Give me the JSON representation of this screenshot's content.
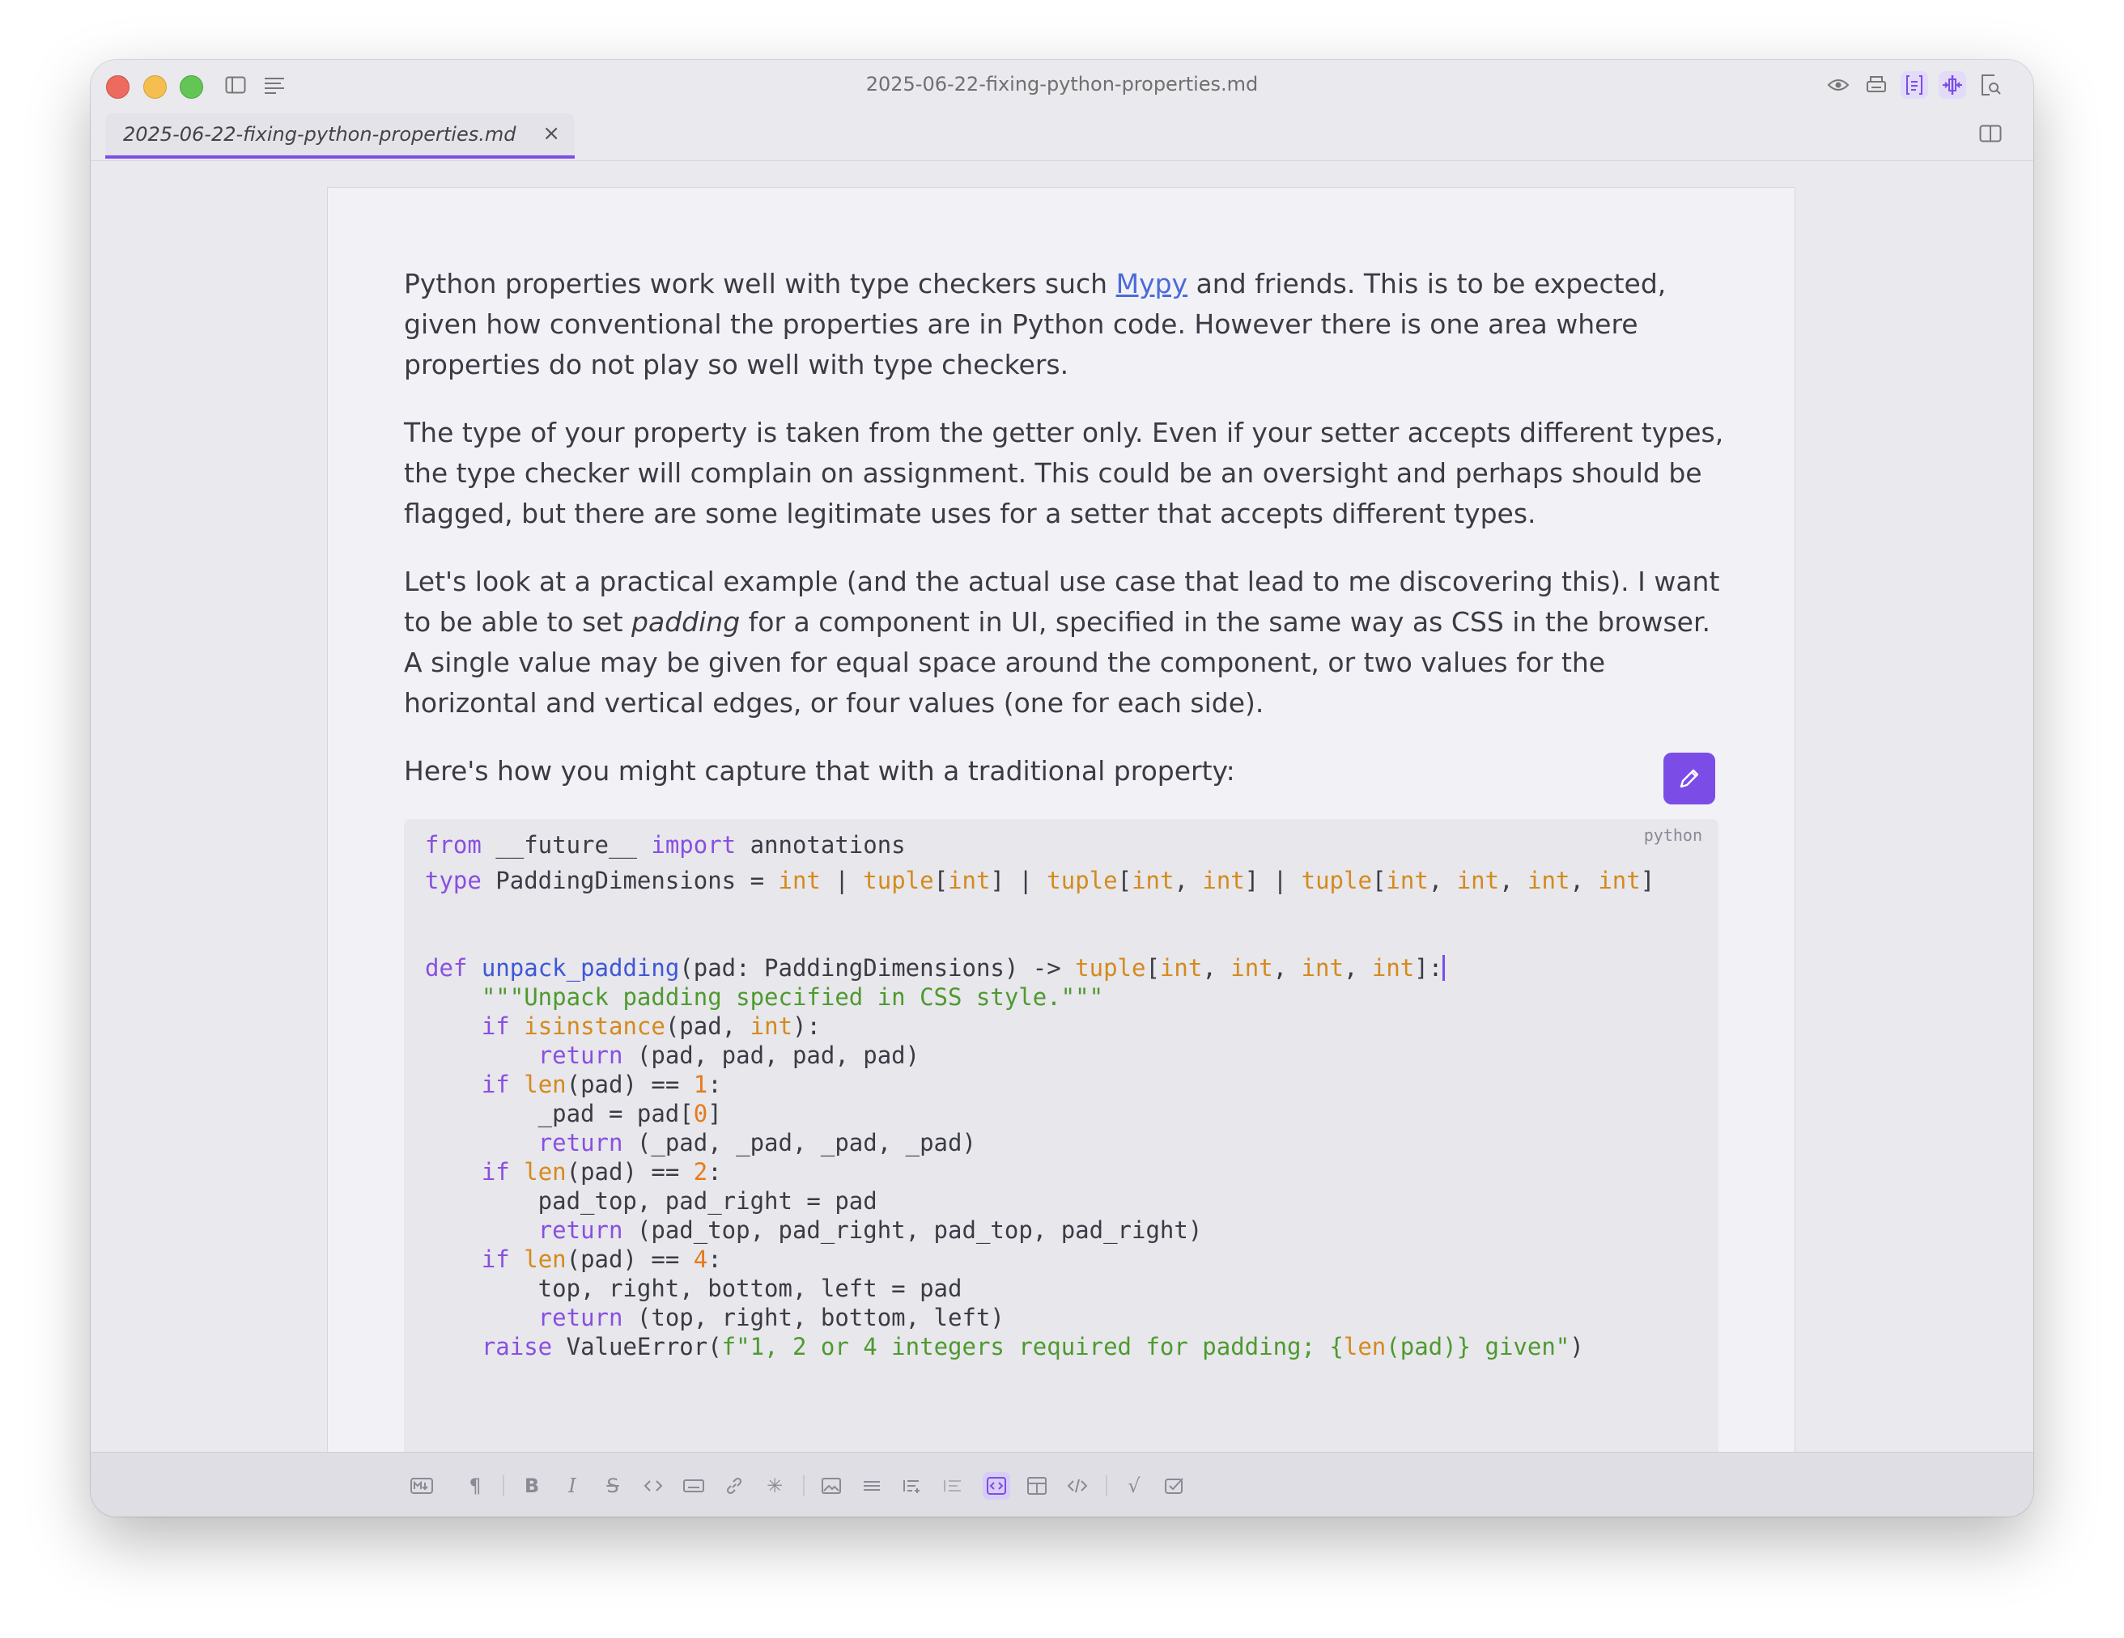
{
  "window": {
    "title": "2025-06-22-fixing-python-properties.md"
  },
  "tab": {
    "label": "2025-06-22-fixing-python-properties.md",
    "close": "×"
  },
  "prose": {
    "p1_before": "Python properties work well with type checkers such ",
    "p1_link": "Mypy",
    "p1_after": " and friends. This is to be expected, given how conventional the properties are in Python code. However there is one area where properties do not play so well with type checkers.",
    "p2": "The type of your property is taken from the getter only. Even if your setter accepts different types, the type checker will complain on assignment. This could be an oversight and perhaps should be flagged, but there are some legitimate uses for a setter that accepts different types.",
    "p3_before": "Let's look at a practical example (and the actual use case that lead to me discovering this). I want to be able to set ",
    "p3_em": "padding",
    "p3_after": " for a component in UI, specified in the same way as CSS in the browser. A single value may be given for equal space around the component, or two values for the horizontal and vertical edges, or four values (one for each side).",
    "p4": "Here's how you might capture that with a traditional property:"
  },
  "code": {
    "language": "python"
  },
  "colors": {
    "accent": "#7c4de6",
    "keyword": "#8a4fe0",
    "type": "#d58a1c",
    "function": "#3f57d6",
    "string": "#4e9a2e",
    "link": "#4b6bd8"
  },
  "icons": {
    "titlebar": [
      "sidebar-icon",
      "outline-icon",
      "preview-eye-icon",
      "printer-icon",
      "editor-mode-icon",
      "split-mode-icon",
      "find-icon"
    ],
    "bottombar": [
      "markdown-icon",
      "paragraph-icon",
      "bold-icon",
      "italic-icon",
      "strikethrough-icon",
      "inline-code-icon",
      "keyboard-icon",
      "link-icon",
      "asterisk-icon",
      "image-icon",
      "horizontal-rule-icon",
      "list-icon",
      "ordered-list-icon",
      "code-block-icon",
      "table-icon",
      "html-icon",
      "math-icon",
      "checkbox-icon"
    ]
  }
}
